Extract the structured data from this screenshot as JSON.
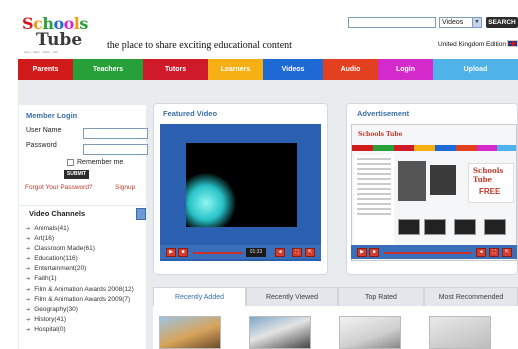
{
  "header": {
    "logo_line1": "Schools",
    "logo_line2": "Tube",
    "logo_small": "seen · learn · share · edit",
    "tagline": "the place to share exciting educational content",
    "search_placeholder": "",
    "search_scope": "Videos",
    "search_button": "SEARCH",
    "edition": "United Kingdom Edition"
  },
  "nav": {
    "items": [
      {
        "label": "Parents",
        "color": "#d11b1b"
      },
      {
        "label": "Teachers",
        "color": "#27a03a"
      },
      {
        "label": "Tutors",
        "color": "#cf1a2a"
      },
      {
        "label": "Learners",
        "color": "#f7b014"
      },
      {
        "label": "Videos",
        "color": "#1e6ad4"
      },
      {
        "label": "Audio",
        "color": "#e2401f"
      },
      {
        "label": "Login",
        "color": "#d42acb"
      },
      {
        "label": "Upload",
        "color": "#4fb3ea"
      }
    ]
  },
  "login": {
    "title": "Member Login",
    "username_label": "User Name",
    "password_label": "Password",
    "remember_label": "Remember me",
    "submit_label": "SUBMIT",
    "forgot_label": "Forgot Your Password?",
    "signup_label": "Signup"
  },
  "channels": {
    "title": "Video Channels",
    "items": [
      "Animals(41)",
      "Art(16)",
      "Classroom Made(61)",
      "Education(116)",
      "Entertainment(20)",
      "Faith(1)",
      "Film & Animation Awards 2008(12)",
      "Film & Animation Awards 2009(7)",
      "Geography(30)",
      "History(41)",
      "Hospital(0)"
    ]
  },
  "featured": {
    "title": "Featured Video",
    "time": "01:33"
  },
  "advertisement": {
    "title": "Advertisement",
    "mini_logo": "Schools Tube",
    "free_logo": "Schools Tube",
    "free_text": "FREE"
  },
  "tabs": [
    {
      "label": "Recently Added",
      "active": true
    },
    {
      "label": "Recently Viewed",
      "active": false
    },
    {
      "label": "Top Rated",
      "active": false
    },
    {
      "label": "Most Recommended",
      "active": false
    }
  ]
}
